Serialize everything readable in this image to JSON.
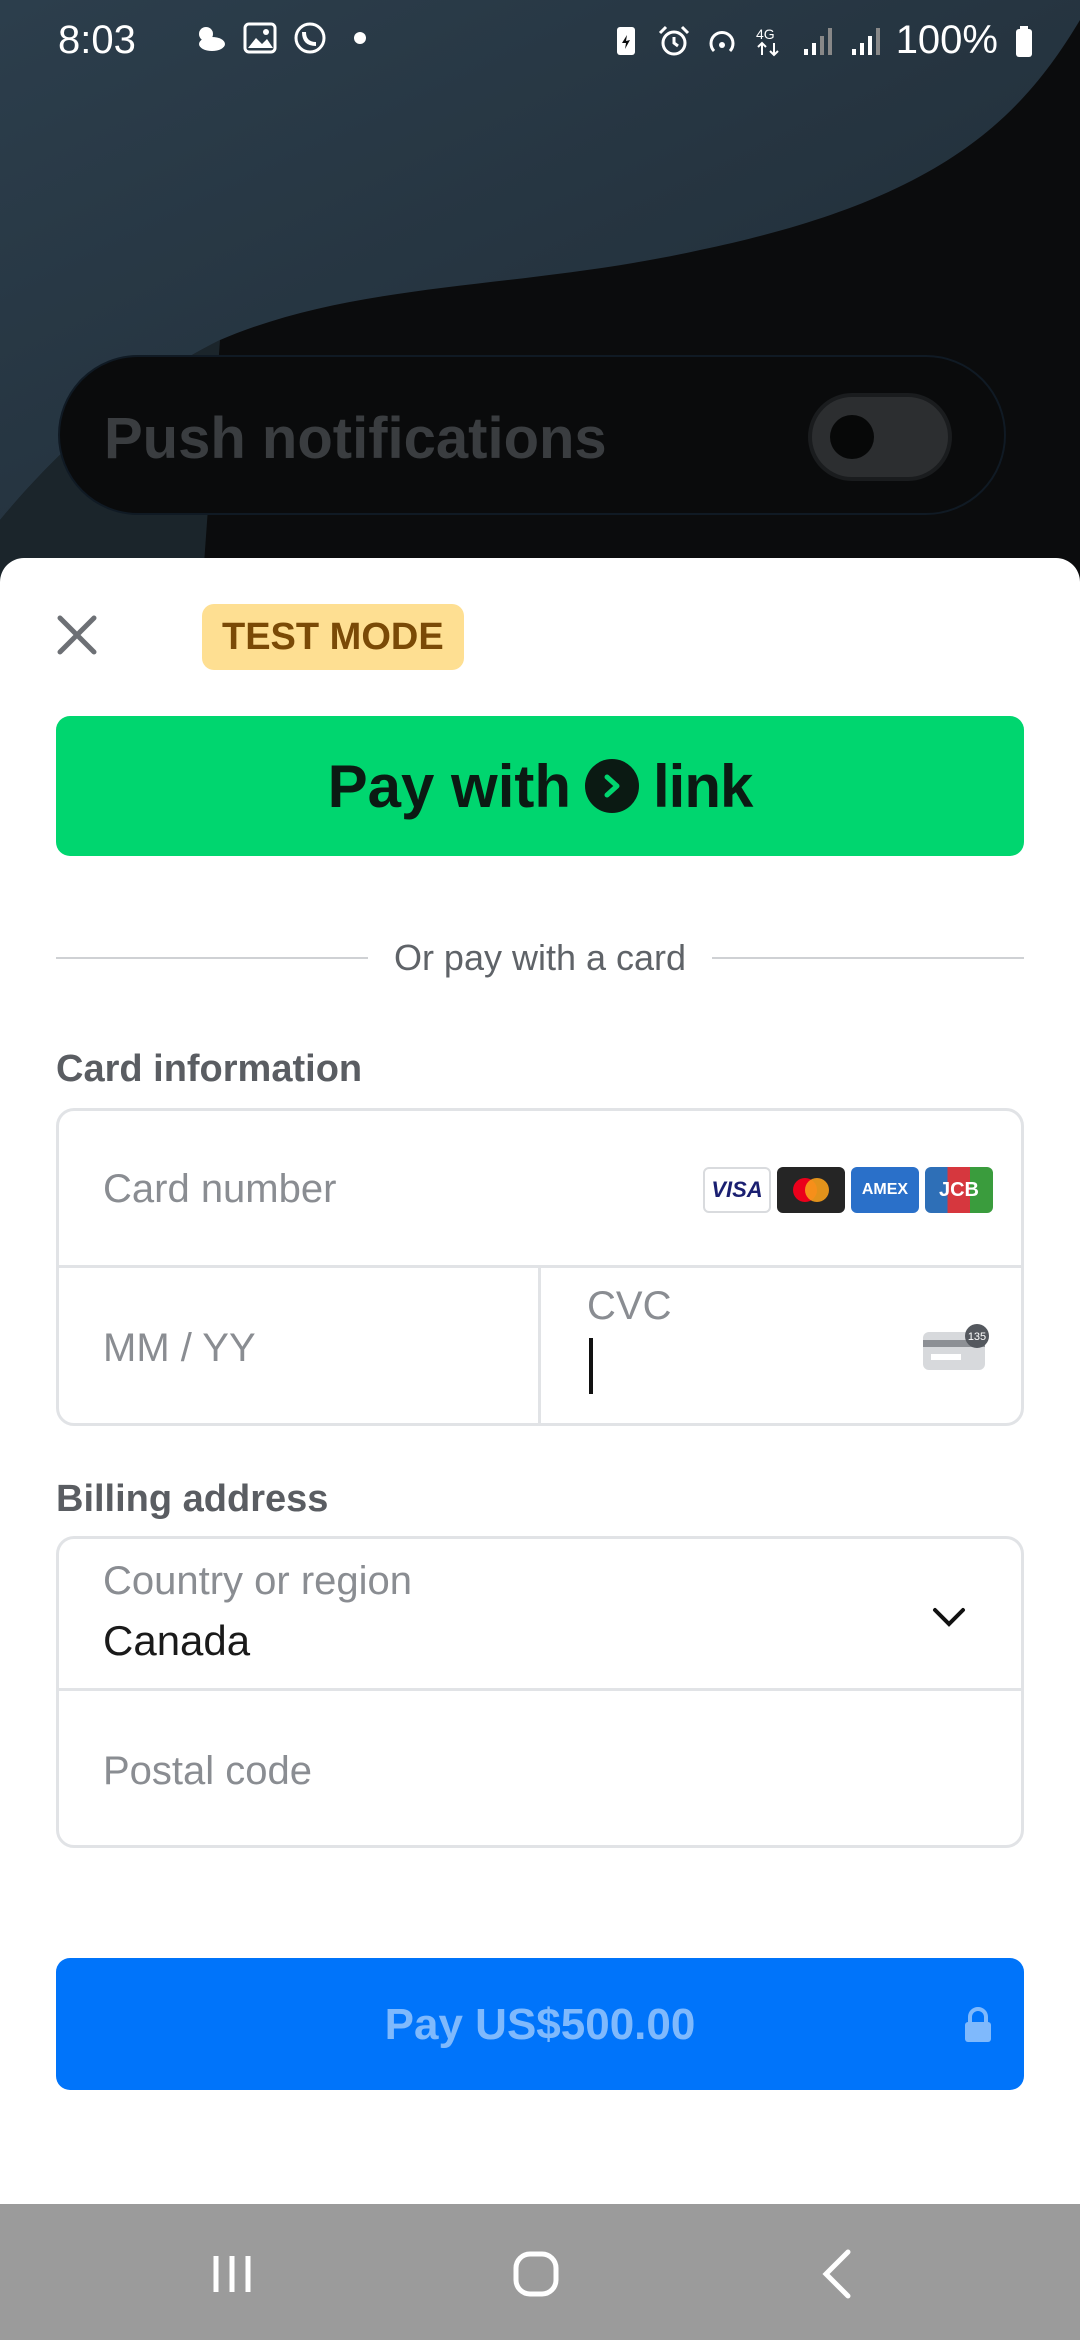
{
  "statusbar": {
    "time": "8:03",
    "battery_text": "100%",
    "left_icons": [
      "weather-icon",
      "gallery-icon",
      "whatsapp-icon",
      "dot-icon"
    ],
    "right_icons": [
      "battery-saver-icon",
      "alarm-icon",
      "hotspot-icon",
      "4g-icon",
      "signal-icon",
      "signal-icon",
      "battery-icon"
    ]
  },
  "background": {
    "push_label": "Push notifications"
  },
  "sheet": {
    "test_badge": "TEST MODE",
    "link_button": {
      "prefix": "Pay with",
      "brand": "link"
    },
    "divider_text": "Or pay with a card",
    "card_section_label": "Card information",
    "card_number_placeholder": "Card number",
    "brands": [
      "VISA",
      "Mastercard",
      "AMEX",
      "JCB"
    ],
    "expiry_placeholder": "MM / YY",
    "cvc_placeholder": "CVC",
    "cvc_hint": "135",
    "billing_section_label": "Billing address",
    "country_label": "Country or region",
    "country_value": "Canada",
    "postal_placeholder": "Postal code",
    "pay_button": "Pay US$500.00"
  },
  "colors": {
    "link_green": "#00d66f",
    "pay_blue": "#0074fa",
    "badge_bg": "#fedf92"
  }
}
